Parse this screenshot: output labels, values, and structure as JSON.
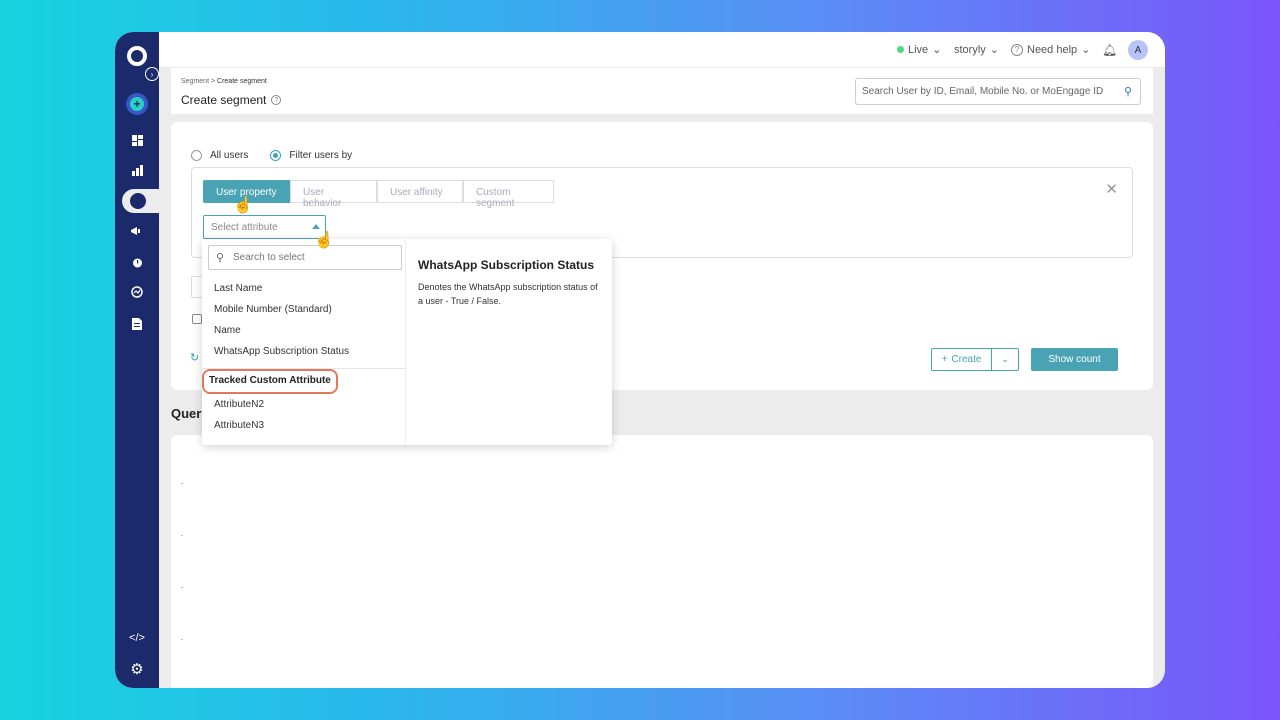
{
  "sidebar": {
    "expand_icon": "chevron-right-icon",
    "icons": [
      "plus-icon",
      "dashboard-icon",
      "bar-chart-icon",
      "pie-chart-icon",
      "megaphone-icon",
      "timer-icon",
      "analytics-icon",
      "document-icon",
      "code-icon",
      "gear-icon"
    ]
  },
  "topbar": {
    "env": "Live",
    "workspace": "storyly",
    "help": "Need help",
    "avatar": "A"
  },
  "header": {
    "breadcrumb_root": "Segment",
    "breadcrumb_sep": ">",
    "breadcrumb_current": "Create segment",
    "title": "Create segment",
    "search_placeholder": "Search User by ID, Email, Mobile No. or MoEngage ID"
  },
  "filter": {
    "option_all": "All users",
    "option_filter": "Filter users by",
    "tabs": [
      "User property",
      "User behavior",
      "User affinity",
      "Custom segment"
    ],
    "select_placeholder": "Select attribute"
  },
  "dropdown": {
    "search_placeholder": "Search to select",
    "items": [
      "Last Name",
      "Mobile Number (Standard)",
      "Name",
      "WhatsApp Subscription Status"
    ],
    "group_label": "Tracked Custom Attribute",
    "group_items": [
      "AttributeN2",
      "AttributeN3"
    ],
    "detail_title": "WhatsApp Subscription Status",
    "detail_desc": "Denotes the WhatsApp subscription status of a user - True / False."
  },
  "actions": {
    "create": "Create",
    "show_count": "Show count"
  },
  "query": {
    "title": "Query"
  },
  "colors": {
    "accent": "#4aa3b4",
    "sidebar": "#1a2a6b",
    "highlight": "#e07a5f"
  }
}
